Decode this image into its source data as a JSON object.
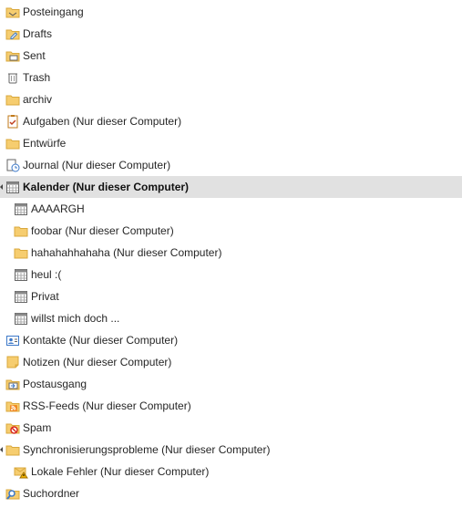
{
  "folders": [
    {
      "name": "posteingang",
      "label": "Posteingang",
      "icon": "inbox-icon",
      "level": 0
    },
    {
      "name": "drafts",
      "label": "Drafts",
      "icon": "drafts-icon",
      "level": 0
    },
    {
      "name": "sent",
      "label": "Sent",
      "icon": "sent-icon",
      "level": 0
    },
    {
      "name": "trash",
      "label": "Trash",
      "icon": "trash-icon",
      "level": 0
    },
    {
      "name": "archiv",
      "label": "archiv",
      "icon": "folder-icon",
      "level": 0
    },
    {
      "name": "aufgaben",
      "label": "Aufgaben (Nur dieser Computer)",
      "icon": "tasks-icon",
      "level": 0
    },
    {
      "name": "entwuerfe",
      "label": "Entwürfe",
      "icon": "folder-icon",
      "level": 0
    },
    {
      "name": "journal",
      "label": "Journal (Nur dieser Computer)",
      "icon": "journal-icon",
      "level": 0
    },
    {
      "name": "kalender",
      "label": "Kalender (Nur dieser Computer)",
      "icon": "calendar-icon",
      "level": 0,
      "selected": true,
      "expanded": true
    },
    {
      "name": "aaaargh",
      "label": "AAAARGH",
      "icon": "calendar-icon",
      "level": 1
    },
    {
      "name": "foobar",
      "label": "foobar (Nur dieser Computer)",
      "icon": "folder-icon",
      "level": 1
    },
    {
      "name": "hahahahhahaha",
      "label": "hahahahhahaha (Nur dieser Computer)",
      "icon": "folder-icon",
      "level": 1
    },
    {
      "name": "heul",
      "label": "heul :(",
      "icon": "calendar-icon",
      "level": 1
    },
    {
      "name": "privat",
      "label": "Privat",
      "icon": "calendar-icon",
      "level": 1
    },
    {
      "name": "willst-mich-doch",
      "label": "willst mich doch ...",
      "icon": "calendar-icon",
      "level": 1
    },
    {
      "name": "kontakte",
      "label": "Kontakte (Nur dieser Computer)",
      "icon": "contacts-icon",
      "level": 0
    },
    {
      "name": "notizen",
      "label": "Notizen (Nur dieser Computer)",
      "icon": "notes-icon",
      "level": 0
    },
    {
      "name": "postausgang",
      "label": "Postausgang",
      "icon": "outbox-icon",
      "level": 0
    },
    {
      "name": "rss-feeds",
      "label": "RSS-Feeds (Nur dieser Computer)",
      "icon": "rss-icon",
      "level": 0
    },
    {
      "name": "spam",
      "label": "Spam",
      "icon": "spam-icon",
      "level": 0
    },
    {
      "name": "synchronisierungsprobleme",
      "label": "Synchronisierungsprobleme (Nur dieser Computer)",
      "icon": "folder-icon",
      "level": 0,
      "expanded": true
    },
    {
      "name": "lokale-fehler",
      "label": "Lokale Fehler (Nur dieser Computer)",
      "icon": "warning-mail-icon",
      "level": 1
    },
    {
      "name": "suchordner",
      "label": "Suchordner",
      "icon": "search-folder-icon",
      "level": 0
    }
  ],
  "colors": {
    "folder": "#f0c060",
    "selection": "#e1e1e1",
    "text": "#262626",
    "rss": "#f08a24",
    "spam": "#d9281e",
    "accent": "#3c78c8"
  }
}
